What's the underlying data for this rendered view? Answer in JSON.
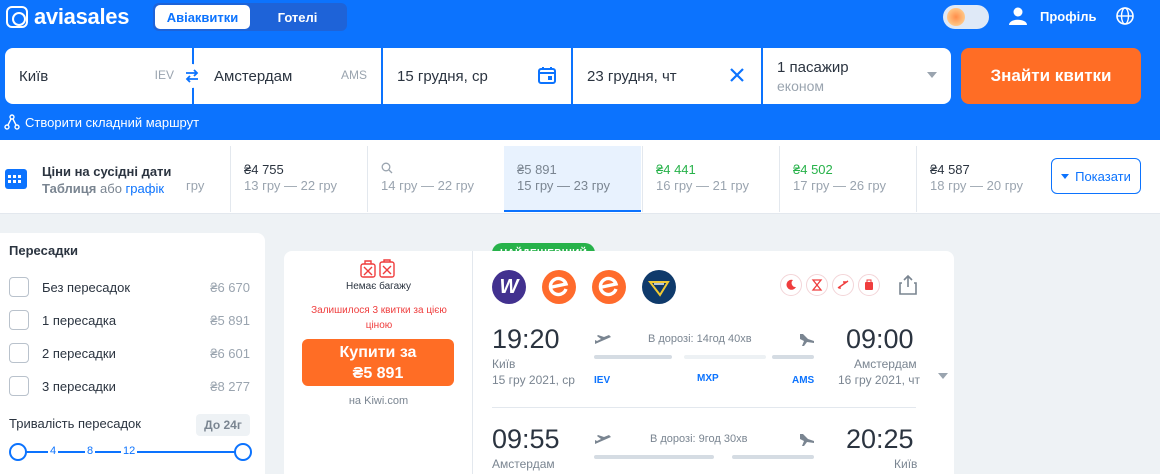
{
  "header": {
    "logo_text": "aviasales",
    "tabs": [
      {
        "label": "Авіаквитки",
        "active": true
      },
      {
        "label": "Готелі",
        "active": false
      }
    ],
    "profile_label": "Профіль"
  },
  "search": {
    "origin": "Київ",
    "origin_code": "IEV",
    "destination": "Амстердам",
    "destination_code": "AMS",
    "depart_date": "15 грудня, ср",
    "return_date": "23 грудня, чт",
    "passengers": "1 пасажир",
    "cabin": "економ",
    "submit_label": "Знайти квитки",
    "complex_route_label": "Створити складний маршрут"
  },
  "dates_strip": {
    "title": "Ціни на сусідні дати",
    "sub_table": "Таблиця",
    "sub_or": "або",
    "sub_chart": "графік",
    "cells": [
      {
        "price": "",
        "range": "гру"
      },
      {
        "price": "₴4 755",
        "range": "13 гру — 22 гру"
      },
      {
        "price": "",
        "range": "14 гру — 22 гру"
      },
      {
        "price": "₴5 891",
        "range": "15 гру — 23 гру"
      },
      {
        "price": "₴4 441",
        "range": "16 гру — 21 гру"
      },
      {
        "price": "₴4 502",
        "range": "17 гру — 26 гру"
      },
      {
        "price": "₴4 587",
        "range": "18 гру — 20 гру"
      }
    ],
    "show_label": "Показати"
  },
  "filters": {
    "title": "Пересадки",
    "options": [
      {
        "label": "Без пересадок",
        "price": "₴6 670"
      },
      {
        "label": "1 пересадка",
        "price": "₴5 891"
      },
      {
        "label": "2 пересадки",
        "price": "₴6 601"
      },
      {
        "label": "3 пересадки",
        "price": "₴8 277"
      }
    ],
    "duration_label": "Тривалість пересадок",
    "duration_badge": "До 24г",
    "ticks": [
      "4",
      "8",
      "12"
    ]
  },
  "ticket": {
    "badge": "НАЙДЕШЕВШИЙ",
    "baggage": "Немає багажу",
    "warning": "Залишилося 3 квитки за цією ціною",
    "buy_line1": "Купити за",
    "buy_line2": "₴5 891",
    "via": "на Kiwi.com",
    "airline_icons": [
      "wizz-air-icon",
      "eurowings-icon",
      "eurowings-icon",
      "ryanair-icon"
    ],
    "outbound": {
      "dep_time": "19:20",
      "dep_city": "Київ",
      "dep_date": "15 гру 2021, ср",
      "duration": "В дорозі: 14год 40хв",
      "arr_time": "09:00",
      "arr_city": "Амстердам",
      "arr_date": "16 гру 2021, чт",
      "codes": [
        "IEV",
        "MXP",
        "AMS"
      ]
    },
    "inbound": {
      "dep_time": "09:55",
      "dep_city": "Амстердам",
      "duration": "В дорозі: 9год 30хв",
      "arr_time": "20:25",
      "arr_city": "Київ"
    }
  },
  "colors": {
    "brand_blue": "#0c73fe",
    "accent_orange": "#ff6d25",
    "cheap_green": "#27b24a",
    "warning_red": "#ef3d3d"
  }
}
